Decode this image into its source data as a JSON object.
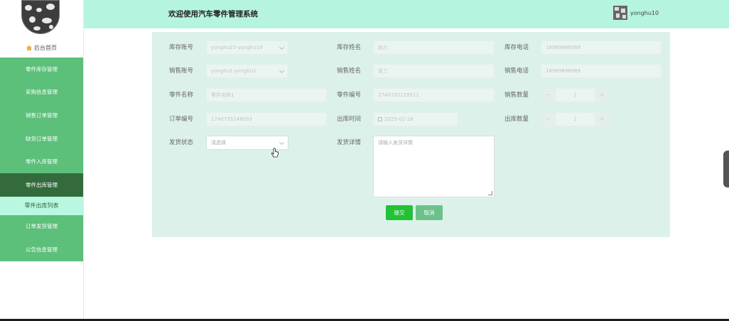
{
  "header": {
    "title": "欢迎使用汽车零件管理系统",
    "username": "yonghu10"
  },
  "sidebar": {
    "home_label": "后台首页",
    "items": [
      {
        "label": "零件库存管理"
      },
      {
        "label": "采购信息管理"
      },
      {
        "label": "销售订单管理"
      },
      {
        "label": "缺货订单管理"
      },
      {
        "label": "零件入库管理"
      },
      {
        "label": "零件出库管理"
      },
      {
        "label": "零件出库列表"
      },
      {
        "label": "订单发货管理"
      },
      {
        "label": "公告信息管理"
      }
    ]
  },
  "form": {
    "kucun_account": {
      "label": "库存账号",
      "value": "yonghu10-yonghu10"
    },
    "kucun_name": {
      "label": "库存姓名",
      "value": "赵六"
    },
    "kucun_phone": {
      "label": "库存电话",
      "value": "18989898989"
    },
    "sales_account": {
      "label": "销售账号",
      "value": "yonghu1-yonghu1"
    },
    "sales_name": {
      "label": "销售姓名",
      "value": "张三"
    },
    "sales_phone": {
      "label": "销售电话",
      "value": "18989898989"
    },
    "part_name": {
      "label": "零件名称",
      "placeholder": "零件名称1"
    },
    "part_no": {
      "label": "零件编号",
      "value": "1740735129511"
    },
    "sales_qty": {
      "label": "销售数量",
      "value": "2"
    },
    "order_no": {
      "label": "订单编号",
      "value": "1740735248093"
    },
    "out_time": {
      "label": "出库时间",
      "value": "2025-02-28"
    },
    "out_qty": {
      "label": "出库数量",
      "value": "2"
    },
    "ship_status": {
      "label": "发货状态",
      "placeholder": "请选择"
    },
    "ship_detail": {
      "label": "发货详情",
      "placeholder": "请输入发货详情"
    },
    "submit_label": "提交",
    "cancel_label": "取消"
  },
  "colors": {
    "header_bg": "#b5f5e0",
    "menu_bg": "#5cbf7a",
    "menu_active": "#336b3d",
    "submit": "#21c235"
  }
}
